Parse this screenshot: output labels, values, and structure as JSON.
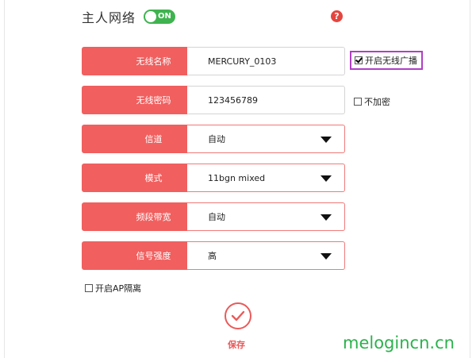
{
  "header": {
    "title": "主人网络",
    "toggle_label": "ON",
    "help_label": "?"
  },
  "form": {
    "rows": [
      {
        "label": "无线名称",
        "value": "MERCURY_0103",
        "type": "input"
      },
      {
        "label": "无线密码",
        "value": "123456789",
        "type": "input"
      },
      {
        "label": "信道",
        "value": "自动",
        "type": "select"
      },
      {
        "label": "模式",
        "value": "11bgn mixed",
        "type": "select"
      },
      {
        "label": "频段带宽",
        "value": "自动",
        "type": "select"
      },
      {
        "label": "信号强度",
        "value": "高",
        "type": "select"
      }
    ]
  },
  "options": {
    "broadcast_label": "开启无线广播",
    "broadcast_checked": true,
    "no_encrypt_label": "不加密",
    "no_encrypt_checked": false,
    "ap_isolation_label": "开启AP隔离",
    "ap_isolation_checked": false
  },
  "actions": {
    "save_label": "保存"
  },
  "watermark": "melogincn.cn",
  "colors": {
    "accent_red": "#f15f5f",
    "toggle_green": "#3fb34f",
    "highlight_purple": "#b03fc4",
    "watermark_green": "#2bb24c"
  }
}
